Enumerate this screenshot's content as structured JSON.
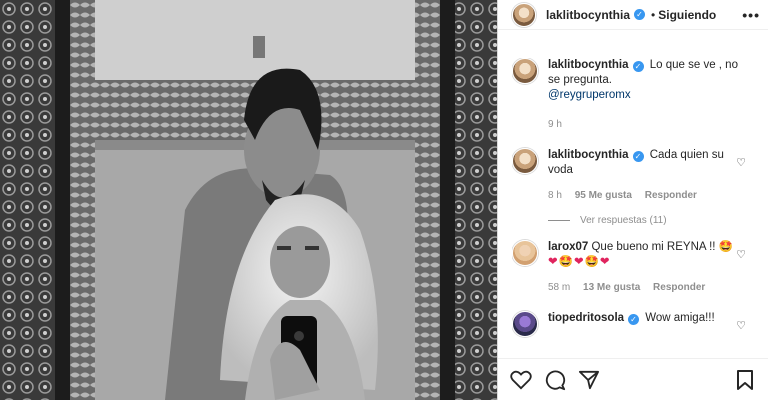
{
  "post": {
    "author": "laklitbocynthia",
    "follow_status": "Siguiendo",
    "dot": "•",
    "more": "•••"
  },
  "caption": {
    "user": "laklitbocynthia",
    "text": "Lo que se ve , no se pregunta.",
    "mention": "@reygruperomx",
    "time": "9 h"
  },
  "comments": [
    {
      "user": "laklitbocynthia",
      "text": "Cada quien su voda",
      "time": "8 h",
      "likes": "95 Me gusta",
      "reply": "Responder",
      "view_replies": "Ver respuestas (11)"
    },
    {
      "user": "larox07",
      "text": "Que bueno mi REYNA !!",
      "emojis": "🤩❤🤩❤🤩❤",
      "time": "58 m",
      "likes": "13 Me gusta",
      "reply": "Responder"
    },
    {
      "user": "tiopedritosola",
      "text": "Wow amiga!!!"
    }
  ],
  "icons": {
    "like": "heart-icon",
    "comment": "comment-icon",
    "share": "share-icon",
    "save": "bookmark-icon",
    "verified": "verified-badge-icon"
  },
  "colors": {
    "verified": "#3897f0",
    "mention": "#00376b",
    "muted": "#8e8e8e"
  }
}
